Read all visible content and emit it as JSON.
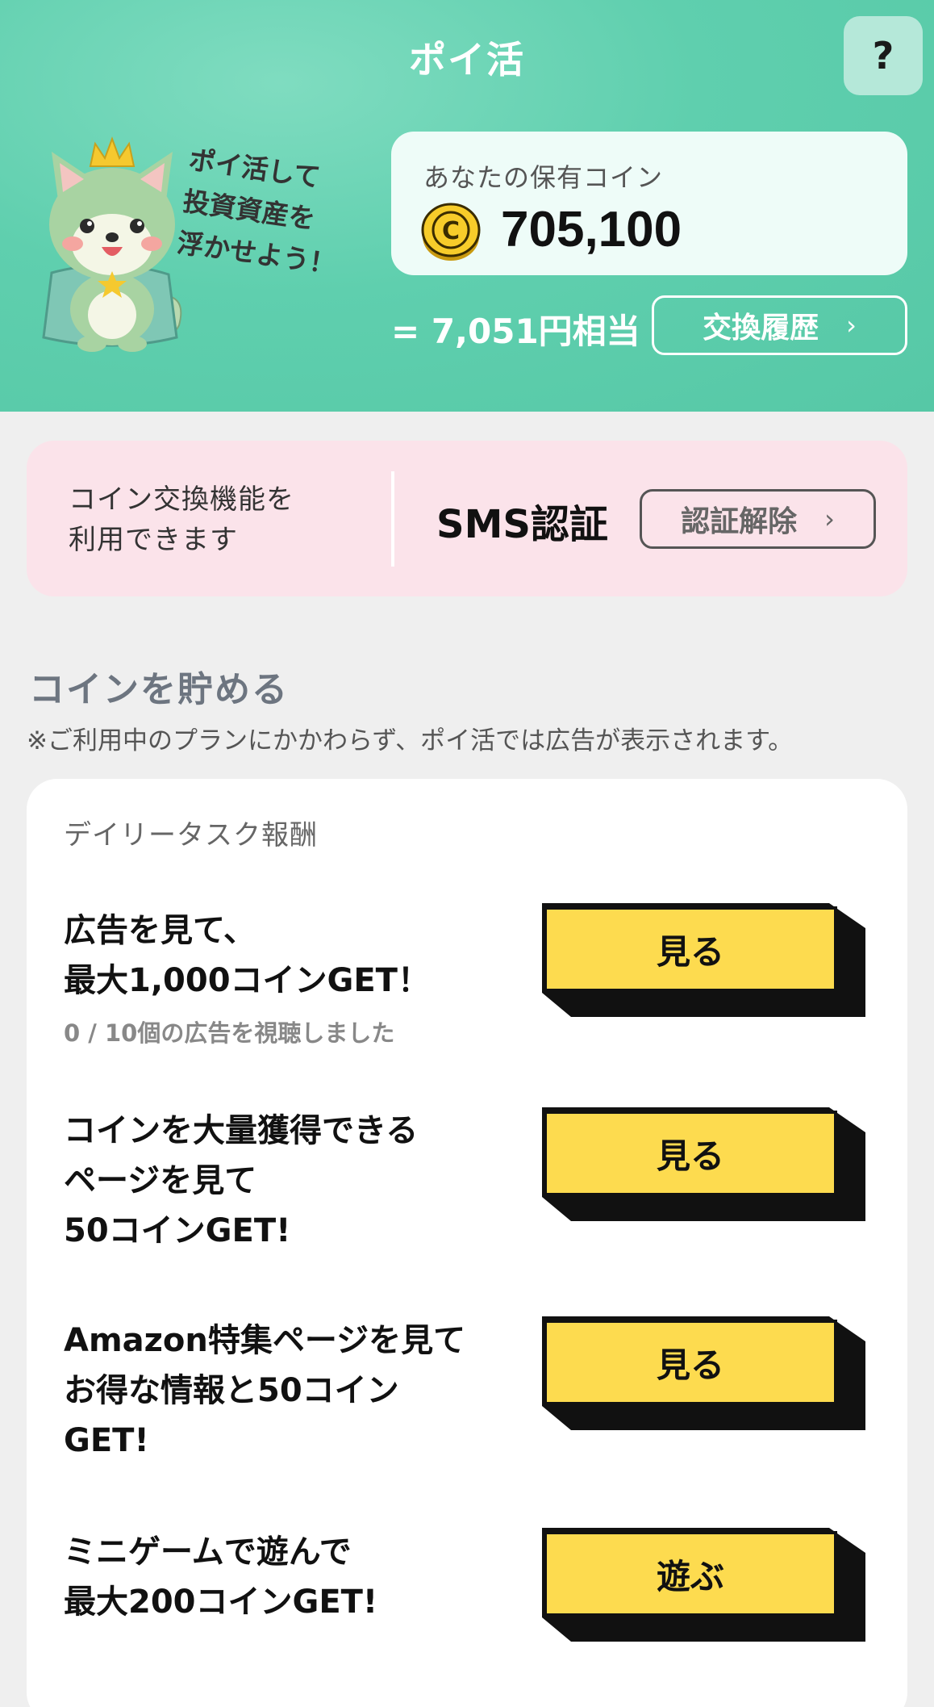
{
  "header": {
    "title": "ポイ活",
    "help_label": "?",
    "tagline": [
      "ポイ活して",
      "投資資産を",
      "浮かせよう！"
    ]
  },
  "coins": {
    "label": "あなたの保有コイン",
    "coin_icon_letter": "C",
    "amount": "705,100",
    "yen_equivalent": "= 7,051円相当",
    "history_button": "交換履歴"
  },
  "sms": {
    "description": [
      "コイン交換機能を",
      "利用できます"
    ],
    "status_label": "SMS認証",
    "unlink_button": "認証解除"
  },
  "section": {
    "title": "コインを貯める",
    "note": "※ご利用中のプランにかかわらず、ポイ活では広告が表示されます。"
  },
  "daily_tasks": {
    "title": "デイリータスク報酬",
    "tasks": [
      {
        "lines": [
          "広告を見て、",
          "最大1,000コインGET！"
        ],
        "sub": "0 / 10個の広告を視聴しました",
        "button": "見る"
      },
      {
        "lines": [
          "コインを大量獲得できる",
          "ページを見て",
          "50コインGET!"
        ],
        "button": "見る"
      },
      {
        "lines": [
          "Amazon特集ページを見て",
          "お得な情報と50コイン",
          "GET!"
        ],
        "button": "見る"
      },
      {
        "lines": [
          "ミニゲームで遊んで",
          "最大200コインGET!"
        ],
        "button": "遊ぶ"
      }
    ]
  },
  "colors": {
    "header_bg": "#5fcfae",
    "sms_bg": "#fbe3ea",
    "button_yellow": "#fddb4f",
    "page_bg": "#efefef"
  }
}
